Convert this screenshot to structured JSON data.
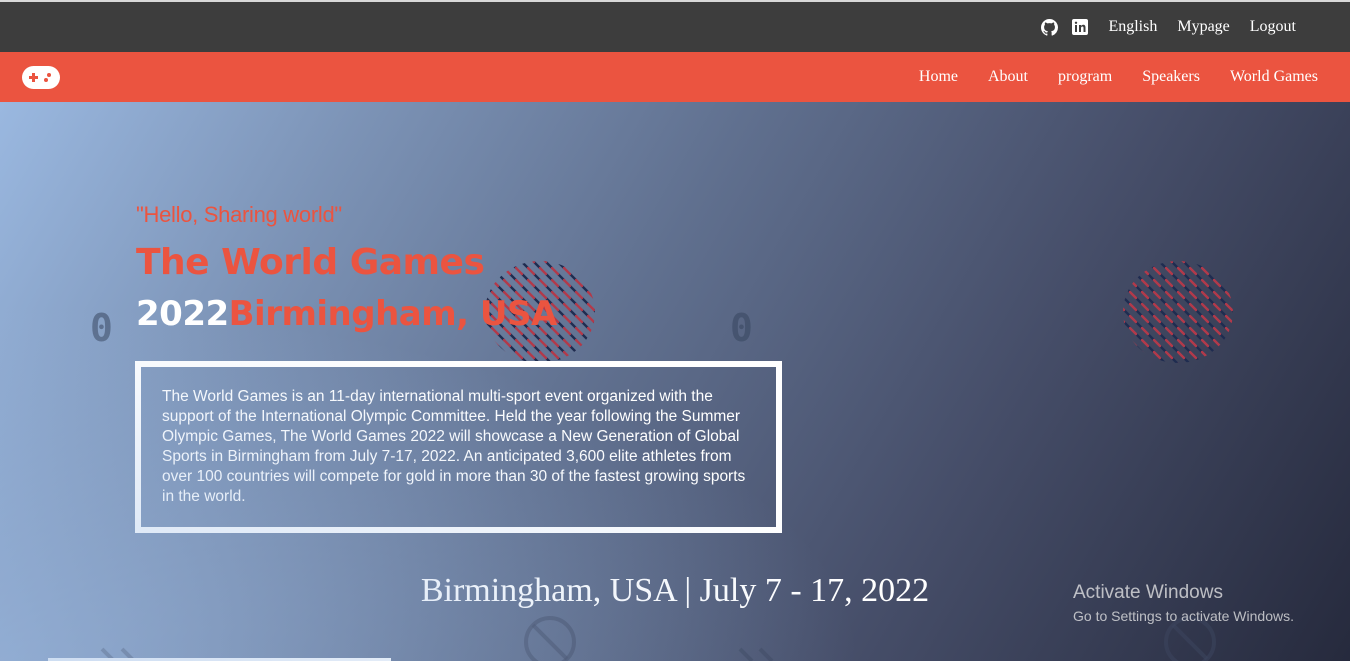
{
  "topbar": {
    "icons": [
      "github-icon",
      "linkedin-icon"
    ],
    "links": [
      "English",
      "Mypage",
      "Logout"
    ]
  },
  "navbar": {
    "logo": "gamepad-icon",
    "items": [
      "Home",
      "About",
      "program",
      "Speakers",
      "World Games"
    ]
  },
  "hero": {
    "tagline": "\"Hello, Sharing world\"",
    "title_line1": "The World Games",
    "title_year": "2022",
    "title_location": "Birmingham, USA",
    "description": "The World Games is an 11-day international multi-sport event organized with the support of the International Olympic Committee. Held the year following the Summer Olympic Games, The World Games 2022 will showcase a New Generation of Global Sports in Birmingham from July 7-17, 2022. An anticipated 3,600 elite athletes from over 100 countries will compete for gold in more than 30 of the fastest growing sports in the world.",
    "dateline": "Birmingham, USA | July 7 - 17, 2022",
    "decor_zero": "0"
  },
  "watermark": {
    "title": "Activate Windows",
    "subtitle": "Go to Settings to activate Windows."
  },
  "colors": {
    "accent": "#eb5440",
    "topbar": "#3d3d3d",
    "white": "#ffffff"
  }
}
